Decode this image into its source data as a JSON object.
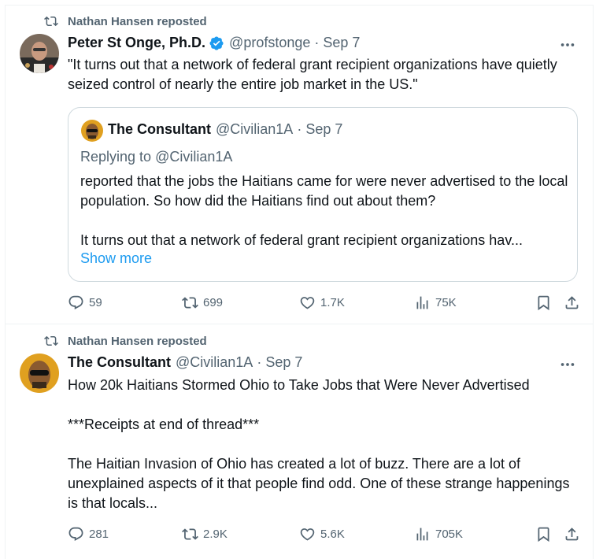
{
  "posts": [
    {
      "repost_label": "Nathan Hansen reposted",
      "author_name": "Peter St Onge, Ph.D.",
      "author_handle": "@profstonge",
      "separator": "·",
      "date": "Sep 7",
      "verified": true,
      "text": "\"It turns out that a network of federal grant recipient organizations have quietly seized control of nearly the entire job market in the US.\"",
      "quote": {
        "author_name": "The Consultant",
        "author_handle": "@Civilian1A",
        "separator": "·",
        "date": "Sep 7",
        "replying_prefix": "Replying to ",
        "replying_to": "@Civilian1A",
        "text": "reported that the jobs the Haitians came for were never advertised to the local population. So how did the Haitians find out about them?\n\nIt turns out that a network of federal grant recipient organizations hav...",
        "show_more": "Show more"
      },
      "actions": {
        "replies": "59",
        "reposts": "699",
        "likes": "1.7K",
        "views": "75K"
      }
    },
    {
      "repost_label": "Nathan Hansen reposted",
      "author_name": "The Consultant",
      "author_handle": "@Civilian1A",
      "separator": "·",
      "date": "Sep 7",
      "verified": false,
      "text": "How 20k Haitians Stormed Ohio to Take Jobs that Were Never Advertised\n\n***Receipts at end of thread***\n\nThe Haitian Invasion of Ohio has created a lot of buzz. There are a lot of unexplained aspects of it that people find odd. One of these strange happenings is that locals...",
      "actions": {
        "replies": "281",
        "reposts": "2.9K",
        "likes": "5.6K",
        "views": "705K"
      }
    }
  ],
  "colors": {
    "text": "#0f1419",
    "secondary": "#536471",
    "accent": "#1d9bf0",
    "border": "#eff3f4"
  },
  "icons": [
    "repost-icon",
    "verified-badge-icon",
    "more-icon",
    "reply-icon",
    "like-icon",
    "views-icon",
    "bookmark-icon",
    "share-icon"
  ]
}
